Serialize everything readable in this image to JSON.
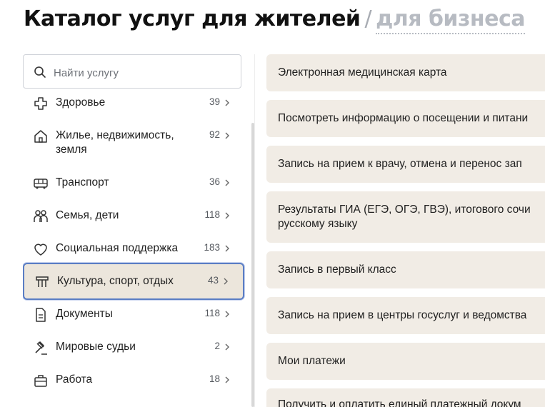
{
  "header": {
    "title": "Каталог услуг для жителей",
    "separator": "/",
    "business_link": "для бизнеса"
  },
  "search": {
    "placeholder": "Найти услугу",
    "value": ""
  },
  "categories": [
    {
      "label": "Здоровье",
      "count": "39",
      "icon": "health-cross-icon",
      "active": false
    },
    {
      "label": "Жилье, недвижимость, земля",
      "count": "92",
      "icon": "house-icon",
      "active": false
    },
    {
      "label": "Транспорт",
      "count": "36",
      "icon": "bus-icon",
      "active": false
    },
    {
      "label": "Семья, дети",
      "count": "118",
      "icon": "family-icon",
      "active": false
    },
    {
      "label": "Социальная поддержка",
      "count": "183",
      "icon": "heart-icon",
      "active": false
    },
    {
      "label": "Культура, спорт, отдых",
      "count": "43",
      "icon": "theater-icon",
      "active": true
    },
    {
      "label": "Документы",
      "count": "118",
      "icon": "document-icon",
      "active": false
    },
    {
      "label": "Мировые судьи",
      "count": "2",
      "icon": "gavel-icon",
      "active": false
    },
    {
      "label": "Работа",
      "count": "18",
      "icon": "briefcase-icon",
      "active": false
    }
  ],
  "services": [
    {
      "label": "Электронная медицинская карта"
    },
    {
      "label": "Посмотреть информацию о посещении и питани"
    },
    {
      "label": "Запись на прием к врачу, отмена и перенос зап"
    },
    {
      "label": "Результаты ГИА (ЕГЭ, ОГЭ, ГВЭ), итогового сочи\nрусскому языку"
    },
    {
      "label": "Запись в первый класс"
    },
    {
      "label": "Запись на прием в центры госуслуг и ведомства"
    },
    {
      "label": "Мои платежи"
    },
    {
      "label": "Получить и оплатить единый платежный докум"
    }
  ],
  "colors": {
    "accent_border": "#5a7dc4",
    "active_bg": "#ece6dc",
    "card_bg": "#f1ece5"
  }
}
